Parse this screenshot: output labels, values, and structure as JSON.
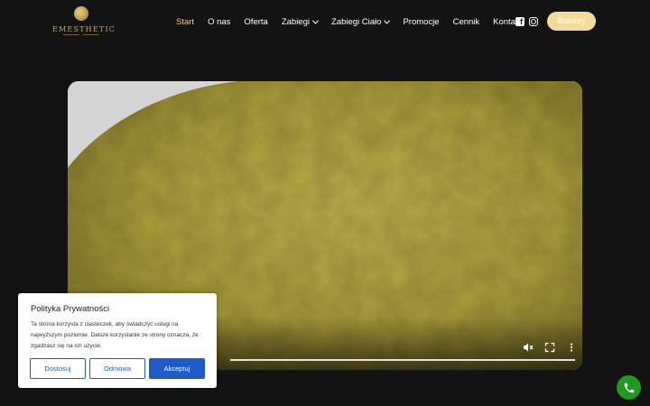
{
  "header": {
    "logo_text": "EMESTHETIC",
    "nav": [
      {
        "label": "Start",
        "active": true,
        "dropdown": false
      },
      {
        "label": "O nas",
        "active": false,
        "dropdown": false
      },
      {
        "label": "Oferta",
        "active": false,
        "dropdown": false
      },
      {
        "label": "Zabiegi",
        "active": false,
        "dropdown": true
      },
      {
        "label": "Zabiegi Ciało",
        "active": false,
        "dropdown": true
      },
      {
        "label": "Promocje",
        "active": false,
        "dropdown": false
      },
      {
        "label": "Cennik",
        "active": false,
        "dropdown": false
      },
      {
        "label": "Kontakt",
        "active": false,
        "dropdown": false
      }
    ],
    "social": [
      "facebook-icon",
      "instagram-icon"
    ],
    "cta_label": "Booksy"
  },
  "video": {
    "controls": [
      "mute-icon",
      "fullscreen-icon",
      "more-options-icon"
    ]
  },
  "cookie": {
    "title": "Polityka Prywatności",
    "text": "Ta strona korzysta z ciasteczek, aby świadczyć usługi na najwyższym poziomie. Dalsze korzystanie ze strony oznacza, że zgadzasz się na ich użycie.",
    "buttons": {
      "customize": "Dostosuj",
      "reject": "Odmowa",
      "accept": "Akceptuj"
    }
  },
  "colors": {
    "background": "#131313",
    "accent_gold": "#e8cf84",
    "booksy_button": "#f3dc9a",
    "cookie_blue": "#1e5ac8",
    "call_green": "#1e9a1e"
  }
}
